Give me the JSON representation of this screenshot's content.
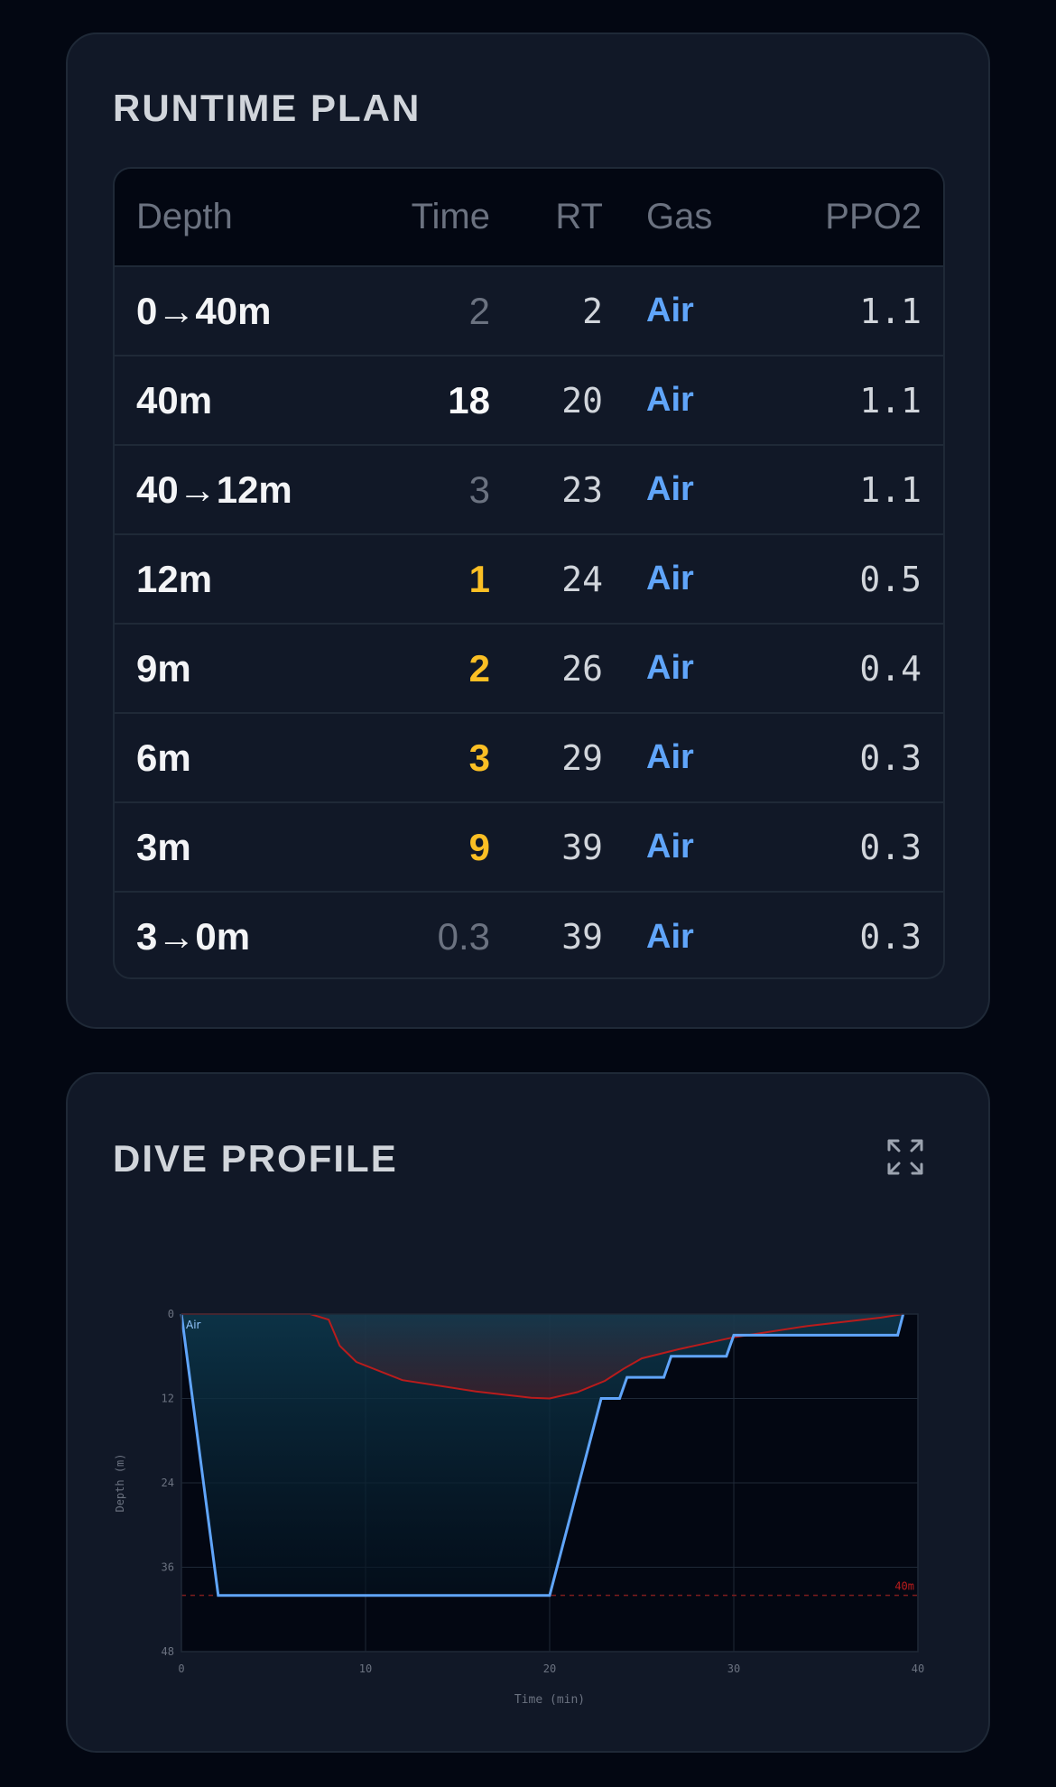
{
  "runtime_plan": {
    "title": "RUNTIME PLAN",
    "columns": [
      "Depth",
      "Time",
      "RT",
      "Gas",
      "PPO2"
    ],
    "rows": [
      {
        "depth": "0→40m",
        "time": "2",
        "rt": "2",
        "gas": "Air",
        "ppo2": "1.1",
        "kind": "travel"
      },
      {
        "depth": "40m",
        "time": "18",
        "rt": "20",
        "gas": "Air",
        "ppo2": "1.1",
        "kind": "bottom"
      },
      {
        "depth": "40→12m",
        "time": "3",
        "rt": "23",
        "gas": "Air",
        "ppo2": "1.1",
        "kind": "travel"
      },
      {
        "depth": "12m",
        "time": "1",
        "rt": "24",
        "gas": "Air",
        "ppo2": "0.5",
        "kind": "stop"
      },
      {
        "depth": "9m",
        "time": "2",
        "rt": "26",
        "gas": "Air",
        "ppo2": "0.4",
        "kind": "stop"
      },
      {
        "depth": "6m",
        "time": "3",
        "rt": "29",
        "gas": "Air",
        "ppo2": "0.3",
        "kind": "stop"
      },
      {
        "depth": "3m",
        "time": "9",
        "rt": "39",
        "gas": "Air",
        "ppo2": "0.3",
        "kind": "stop"
      },
      {
        "depth": "3→0m",
        "time": "0.3",
        "rt": "39",
        "gas": "Air",
        "ppo2": "0.3",
        "kind": "travel"
      }
    ]
  },
  "dive_profile": {
    "title": "DIVE PROFILE",
    "expand_icon": "expand-icon"
  },
  "colors": {
    "profile_line": "#60a5fa",
    "ceiling_line": "#b91c1c",
    "max_depth_line": "#7f1d1d",
    "stop_time": "#fbbf24",
    "gas": "#60a5fa"
  },
  "chart_data": {
    "type": "line",
    "xlabel": "Time (min)",
    "ylabel": "Depth (m)",
    "xlim": [
      0,
      40
    ],
    "ylim": [
      0,
      48
    ],
    "y_inverted": true,
    "x_ticks": [
      0,
      10,
      20,
      30,
      40
    ],
    "y_ticks": [
      0,
      12,
      24,
      36,
      48
    ],
    "grid": true,
    "series": [
      {
        "name": "profile",
        "x": [
          0,
          2,
          20,
          22.8,
          23.8,
          24.2,
          26.2,
          26.6,
          29.6,
          30,
          38.9,
          39.2
        ],
        "y": [
          0,
          40,
          40,
          12,
          12,
          9,
          9,
          6,
          6,
          3,
          3,
          0
        ]
      },
      {
        "name": "ceiling",
        "x": [
          0,
          7,
          8,
          8.6,
          9.5,
          12,
          16,
          19,
          20,
          21.5,
          23,
          24,
          25,
          27,
          30,
          34,
          38,
          39.2
        ],
        "y": [
          0,
          0,
          0.8,
          4.5,
          6.8,
          9.4,
          11,
          11.9,
          12,
          11.1,
          9.5,
          7.8,
          6.3,
          5,
          3.3,
          1.7,
          0.5,
          0
        ]
      }
    ],
    "annotations": [
      {
        "text": "Air",
        "x": 0,
        "y": 0
      },
      {
        "text": "40m",
        "type": "hline",
        "y": 40
      }
    ]
  }
}
